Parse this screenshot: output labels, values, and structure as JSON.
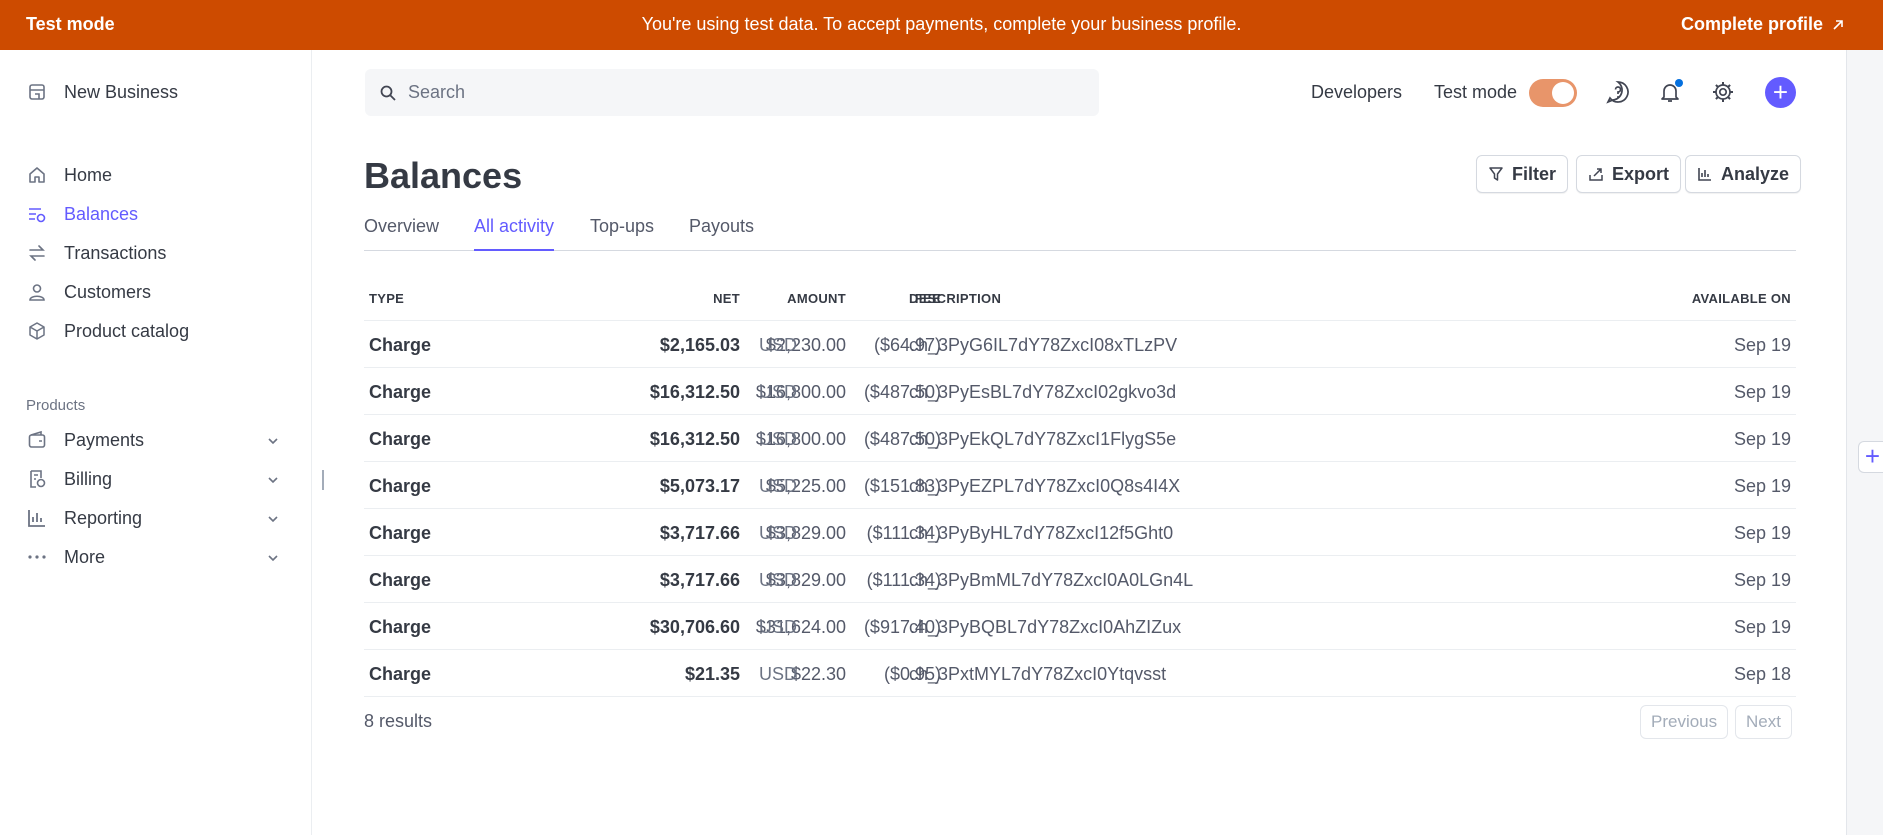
{
  "banner": {
    "mode_label": "Test mode",
    "message": "You're using test data. To accept payments, complete your business profile.",
    "cta_label": "Complete profile",
    "bg_color": "#cd4b00"
  },
  "sidebar": {
    "account_name": "New Business",
    "items": [
      {
        "label": "Home",
        "icon": "home-icon"
      },
      {
        "label": "Balances",
        "icon": "balances-icon",
        "active": true
      },
      {
        "label": "Transactions",
        "icon": "transactions-icon"
      },
      {
        "label": "Customers",
        "icon": "customer-icon"
      },
      {
        "label": "Product catalog",
        "icon": "product-catalog-icon"
      }
    ],
    "products_section_label": "Products",
    "product_items": [
      {
        "label": "Payments",
        "icon": "payments-icon"
      },
      {
        "label": "Billing",
        "icon": "billing-icon"
      },
      {
        "label": "Reporting",
        "icon": "reporting-icon"
      },
      {
        "label": "More",
        "icon": "more-dots-icon"
      }
    ]
  },
  "header": {
    "search_placeholder": "Search",
    "developers_label": "Developers",
    "test_mode_label": "Test mode",
    "test_mode_on": true
  },
  "page": {
    "title": "Balances",
    "actions": {
      "filter": "Filter",
      "export": "Export",
      "analyze": "Analyze"
    },
    "tabs": [
      "Overview",
      "All activity",
      "Top-ups",
      "Payouts"
    ],
    "active_tab": "All activity"
  },
  "table": {
    "headers": {
      "type": "TYPE",
      "net": "NET",
      "amount": "AMOUNT",
      "fee": "FEE",
      "description": "DESCRIPTION",
      "available_on": "AVAILABLE ON"
    },
    "rows": [
      {
        "type": "Charge",
        "net": "$2,165.03",
        "amount": "$2,230.00",
        "fee": "($64.97)",
        "currency": "USD",
        "description": "ch_3PyG6IL7dY78ZxcI08xTLzPV",
        "available_on": "Sep 19"
      },
      {
        "type": "Charge",
        "net": "$16,312.50",
        "amount": "$16,800.00",
        "fee": "($487.50)",
        "currency": "USD",
        "description": "ch_3PyEsBL7dY78ZxcI02gkvo3d",
        "available_on": "Sep 19"
      },
      {
        "type": "Charge",
        "net": "$16,312.50",
        "amount": "$16,800.00",
        "fee": "($487.50)",
        "currency": "USD",
        "description": "ch_3PyEkQL7dY78ZxcI1FlygS5e",
        "available_on": "Sep 19"
      },
      {
        "type": "Charge",
        "net": "$5,073.17",
        "amount": "$5,225.00",
        "fee": "($151.83)",
        "currency": "USD",
        "description": "ch_3PyEZPL7dY78ZxcI0Q8s4I4X",
        "available_on": "Sep 19"
      },
      {
        "type": "Charge",
        "net": "$3,717.66",
        "amount": "$3,829.00",
        "fee": "($111.34)",
        "currency": "USD",
        "description": "ch_3PyByHL7dY78ZxcI12f5Ght0",
        "available_on": "Sep 19"
      },
      {
        "type": "Charge",
        "net": "$3,717.66",
        "amount": "$3,829.00",
        "fee": "($111.34)",
        "currency": "USD",
        "description": "ch_3PyBmML7dY78ZxcI0A0LGn4L",
        "available_on": "Sep 19"
      },
      {
        "type": "Charge",
        "net": "$30,706.60",
        "amount": "$31,624.00",
        "fee": "($917.40)",
        "currency": "USD",
        "description": "ch_3PyBQBL7dY78ZxcI0AhZIZux",
        "available_on": "Sep 19"
      },
      {
        "type": "Charge",
        "net": "$21.35",
        "amount": "$22.30",
        "fee": "($0.95)",
        "currency": "USD",
        "description": "ch_3PxtMYL7dY78ZxcI0Ytqvsst",
        "available_on": "Sep 18"
      }
    ]
  },
  "footer": {
    "results_label": "8 results",
    "previous_label": "Previous",
    "next_label": "Next"
  },
  "colors": {
    "accent": "#635bff",
    "toggle": "#e8956a"
  }
}
